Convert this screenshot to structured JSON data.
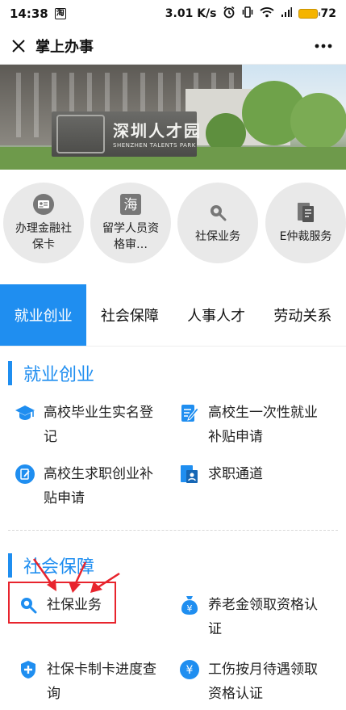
{
  "status_bar": {
    "time": "14:38",
    "app_icon": "淘",
    "network_speed": "3.01 K/s",
    "battery_level": "72",
    "icons": [
      "alarm-icon",
      "vibrate-icon",
      "wifi-icon",
      "signal-icon",
      "battery-icon"
    ]
  },
  "titlebar": {
    "title": "掌上办事",
    "more": "···"
  },
  "banner": {
    "sign_cn": "深圳人才园",
    "sign_en": "SHENZHEN TALENTS PARK"
  },
  "quick_actions": [
    {
      "label": "办理金融社保卡",
      "icon": "id-card-icon"
    },
    {
      "label": "留学人员资格审…",
      "icon": "sea-char-icon",
      "icon_char": "海"
    },
    {
      "label": "社保业务",
      "icon": "search-icon"
    },
    {
      "label": "E仲裁服务",
      "icon": "document-icon"
    }
  ],
  "tabs": [
    {
      "label": "就业创业",
      "active": true
    },
    {
      "label": "社会保障",
      "active": false
    },
    {
      "label": "人事人才",
      "active": false
    },
    {
      "label": "劳动关系",
      "active": false
    }
  ],
  "sections": [
    {
      "title": "就业创业",
      "items": [
        {
          "label_line1": "高校毕业生实名登",
          "label_line2": "记",
          "icon": "graduation-cap-icon"
        },
        {
          "label_line1": "高校生一次性就业",
          "label_line2": "补贴申请",
          "icon": "edit-doc-icon"
        },
        {
          "label_line1": "高校生求职创业补",
          "label_line2": "贴申请",
          "icon": "edit-circle-icon"
        },
        {
          "label_line1": "求职通道",
          "label_line2": "",
          "icon": "job-doc-icon"
        }
      ]
    },
    {
      "title": "社会保障",
      "items": [
        {
          "label_line1": "社保业务",
          "label_line2": "",
          "icon": "search-icon"
        },
        {
          "label_line1": "养老金领取资格认",
          "label_line2": "证",
          "icon": "money-bag-icon"
        },
        {
          "label_line1": "社保卡制卡进度查",
          "label_line2": "询",
          "icon": "plus-shield-icon"
        },
        {
          "label_line1": "工伤按月待遇领取",
          "label_line2": "资格认证",
          "icon": "yen-circle-icon"
        }
      ]
    }
  ],
  "colors": {
    "accent": "#1f8ef0",
    "highlight": "#e8242d",
    "circle_bg": "#e9e9e9"
  }
}
